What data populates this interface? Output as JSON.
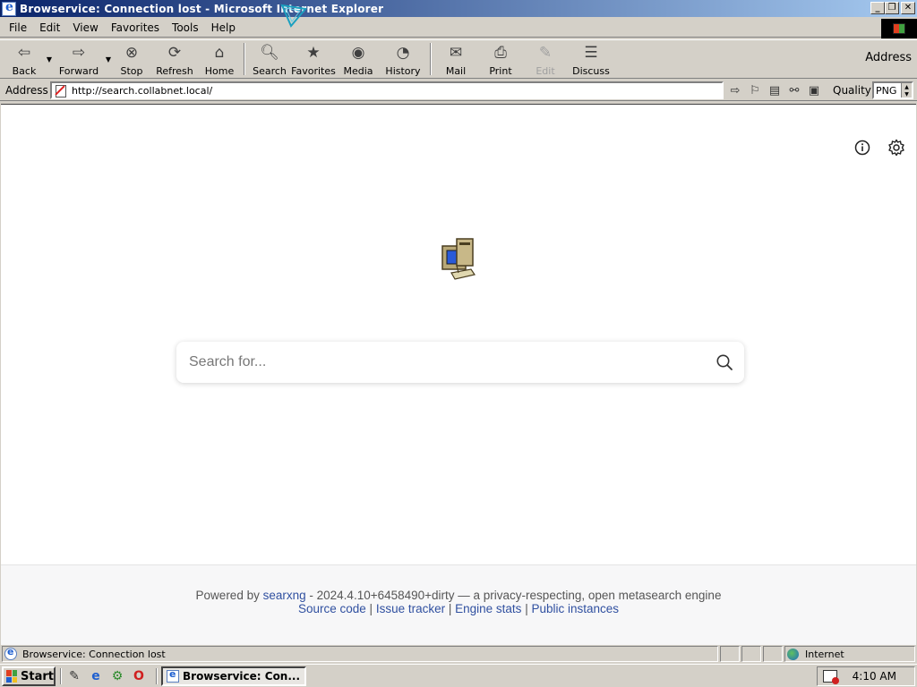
{
  "window": {
    "title": "Browservice: Connection lost - Microsoft Internet Explorer",
    "buttons": {
      "minimize": "_",
      "maximize": "❐",
      "close": "✕"
    }
  },
  "menu": [
    "File",
    "Edit",
    "View",
    "Favorites",
    "Tools",
    "Help"
  ],
  "toolbar": {
    "buttons": [
      {
        "label": "Back",
        "icon": "back-arrow-icon"
      },
      {
        "label": "Forward",
        "icon": "forward-arrow-icon"
      },
      {
        "label": "Stop",
        "icon": "stop-icon"
      },
      {
        "label": "Refresh",
        "icon": "refresh-icon"
      },
      {
        "label": "Home",
        "icon": "home-icon"
      },
      {
        "label": "Search",
        "icon": "search-icon"
      },
      {
        "label": "Favorites",
        "icon": "favorites-icon"
      },
      {
        "label": "Media",
        "icon": "media-icon"
      },
      {
        "label": "History",
        "icon": "history-icon"
      },
      {
        "label": "Mail",
        "icon": "mail-icon"
      },
      {
        "label": "Print",
        "icon": "print-icon"
      },
      {
        "label": "Edit",
        "icon": "edit-icon",
        "disabled": true
      },
      {
        "label": "Discuss",
        "icon": "discuss-icon"
      }
    ],
    "address_label": "Address"
  },
  "addressbar": {
    "label": "Address",
    "url": "http://search.collabnet.local/",
    "quality_label": "Quality",
    "quality_value": "PNG"
  },
  "page": {
    "search_placeholder": "Search for...",
    "footer": {
      "powered_by": "Powered by",
      "engine_link": "searxng",
      "version_text": "- 2024.4.10+6458490+dirty — a privacy-respecting, open metasearch engine",
      "links": [
        "Source code",
        "Issue tracker",
        "Engine stats",
        "Public instances"
      ]
    }
  },
  "status": {
    "text": "Browservice: Connection lost",
    "zone": "Internet"
  },
  "taskbar": {
    "start_label": "Start",
    "task_label": "Browservice: Con...",
    "clock": "4:10 AM"
  }
}
